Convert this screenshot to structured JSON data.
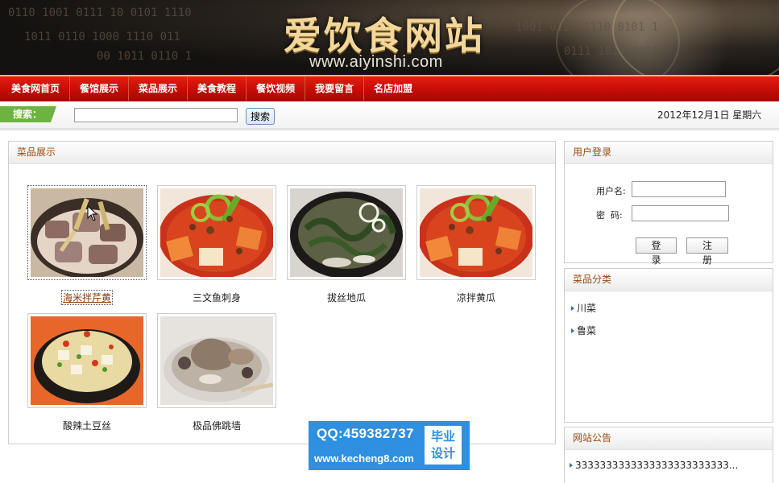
{
  "banner": {
    "title": "爱饮食网站",
    "url": "www.aiyinshi.com"
  },
  "nav": {
    "items": [
      "美食网首页",
      "餐馆展示",
      "菜品展示",
      "美食教程",
      "餐饮视频",
      "我要留言",
      "名店加盟"
    ]
  },
  "search": {
    "label": "搜索：",
    "value": "",
    "button": "搜索",
    "date": "2012年12月1日  星期六"
  },
  "dishes_panel": {
    "title": "菜品展示",
    "items": [
      {
        "name": "海米拌芹黄",
        "image": "braised-meat-bamboo",
        "selected": true
      },
      {
        "name": "三文鱼刺身",
        "image": "red-stew-peppers",
        "selected": false
      },
      {
        "name": "拔丝地瓜",
        "image": "seaweed-soup",
        "selected": false
      },
      {
        "name": "凉拌黄瓜",
        "image": "red-stew-peppers",
        "selected": false
      },
      {
        "name": "酸辣土豆丝",
        "image": "tofu-pot",
        "selected": false
      },
      {
        "name": "极品佛跳墙",
        "image": "poultry-soup",
        "selected": false
      }
    ]
  },
  "login": {
    "title": "用户登录",
    "username_label": "用户名:",
    "password_label": "密  码:",
    "username_value": "",
    "password_value": "",
    "login_button": "登 录",
    "register_button": "注 册"
  },
  "categories": {
    "title": "菜品分类",
    "items": [
      "川菜",
      "鲁菜"
    ]
  },
  "notices": {
    "title": "网站公告",
    "items": [
      "3333333333333333333333333..."
    ]
  },
  "watermark": {
    "qq": "QQ:459382737",
    "url": "www.kecheng8.com",
    "badge_line1": "毕业",
    "badge_line2": "设计"
  },
  "colors": {
    "nav_red": "#c10b05",
    "panel_title": "#9a4a10",
    "search_green": "#6db33f",
    "watermark_blue": "#2f8fe0"
  }
}
